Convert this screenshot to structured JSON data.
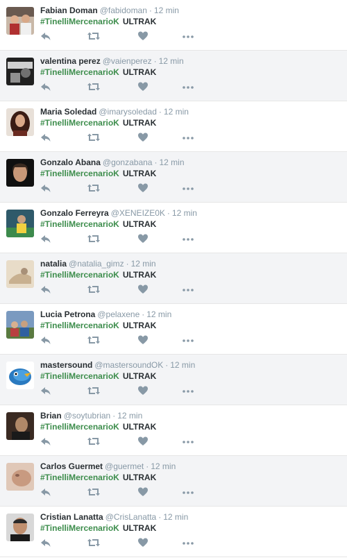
{
  "separator": "·",
  "colors": {
    "hashtag": "#3d8d4c",
    "name": "#292f33",
    "meta": "#8899a6",
    "icon": "#8899a6"
  },
  "icons": {
    "reply": "reply-icon",
    "retweet": "retweet-icon",
    "favorite": "heart-icon",
    "more": "more-dots-icon"
  },
  "tweets": [
    {
      "name": "Fabian Doman",
      "handle": "@fabidoman",
      "time": "12 min",
      "hashtag": "#TinelliMercenarioK",
      "text": "ULTRAK",
      "avatar": "photo of people"
    },
    {
      "name": "valentina perez",
      "handle": "@vaienperez",
      "time": "12 min",
      "hashtag": "#TinelliMercenarioK",
      "text": "ULTRAK",
      "avatar": "black and white photo"
    },
    {
      "name": "Maria Soledad",
      "handle": "@imarysoledad",
      "time": "12 min",
      "hashtag": "#TinelliMercenarioK",
      "text": "ULTRAK",
      "avatar": "woman with dark hair"
    },
    {
      "name": "Gonzalo Abana",
      "handle": "@gonzabana",
      "time": "12 min",
      "hashtag": "#TinelliMercenarioK",
      "text": "ULTRAK",
      "avatar": "portrait on dark background"
    },
    {
      "name": "Gonzalo Ferreyra",
      "handle": "@XENEIZE0K",
      "time": "12 min",
      "hashtag": "#TinelliMercenarioK",
      "text": "ULTRAK",
      "avatar": "soccer player"
    },
    {
      "name": "natalia",
      "handle": "@natalia_gimz",
      "time": "12 min",
      "hashtag": "#TinelliMercenarioK",
      "text": "ULTRAK",
      "avatar": "illustration"
    },
    {
      "name": "Lucia Petrona",
      "handle": "@pelaxene",
      "time": "12 min",
      "hashtag": "#TinelliMercenarioK",
      "text": "ULTRAK",
      "avatar": "group photo outdoors"
    },
    {
      "name": "mastersound",
      "handle": "@mastersoundOK",
      "time": "12 min",
      "hashtag": "#TinelliMercenarioK",
      "text": "ULTRAK",
      "avatar": "blue bird"
    },
    {
      "name": "Brian",
      "handle": "@soytubrian",
      "time": "12 min",
      "hashtag": "#TinelliMercenarioK",
      "text": "ULTRAK",
      "avatar": "portrait photo"
    },
    {
      "name": "Carlos Guermet",
      "handle": "@guermet",
      "time": "12 min",
      "hashtag": "#TinelliMercenarioK",
      "text": "ULTRAK",
      "avatar": "close-up face"
    },
    {
      "name": "Cristian Lanatta",
      "handle": "@CrisLanatta",
      "time": "12 min",
      "hashtag": "#TinelliMercenarioK",
      "text": "ULTRAK",
      "avatar": "man with shaved head"
    }
  ]
}
